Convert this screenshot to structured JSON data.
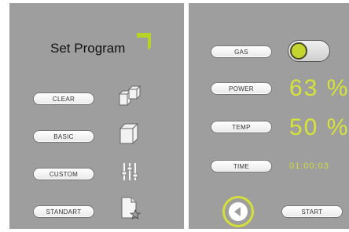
{
  "left": {
    "title": "Set Program",
    "buttons": [
      {
        "label": "CLEAR",
        "icon": "cubes-icon"
      },
      {
        "label": "BASIC",
        "icon": "cube-icon"
      },
      {
        "label": "CUSTOM",
        "icon": "sliders-icon"
      },
      {
        "label": "STANDART",
        "icon": "document-star-icon"
      }
    ]
  },
  "right": {
    "controls": [
      {
        "label": "GAS"
      },
      {
        "label": "POWER",
        "value": "63 %"
      },
      {
        "label": "TEMP",
        "value": "50 %"
      },
      {
        "label": "TIME",
        "value": "01:00:03"
      }
    ],
    "gas_toggle_on": true,
    "start_label": "START"
  },
  "colors": {
    "panel": "#9e9e9e",
    "accent": "#d6e339",
    "pill_bg": "#ffffff"
  }
}
